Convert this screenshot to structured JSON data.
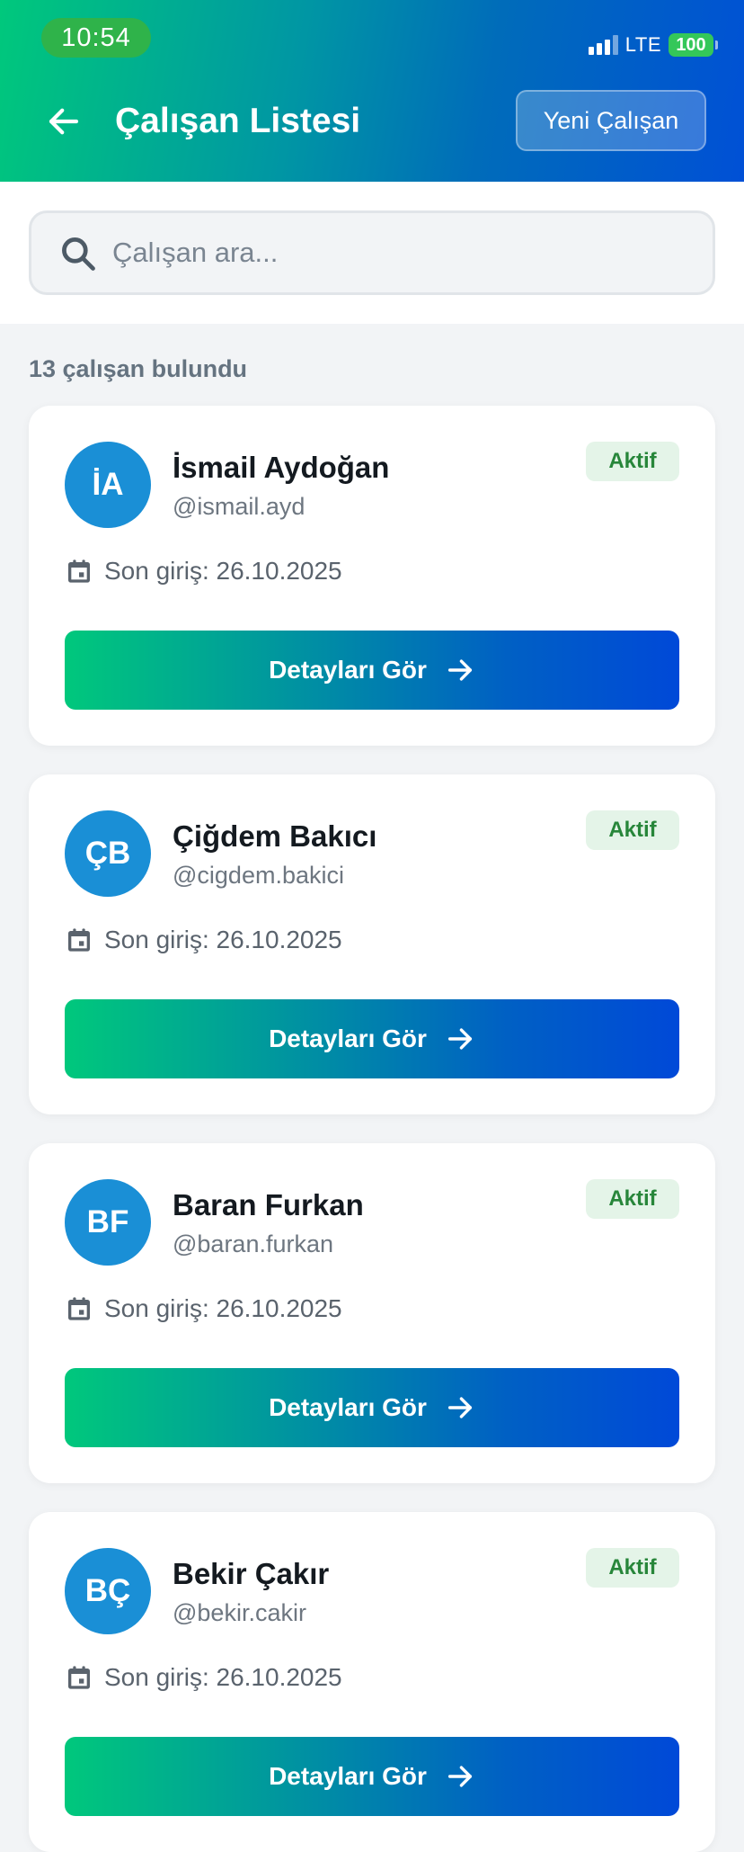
{
  "status_bar": {
    "time": "10:54",
    "network": "LTE",
    "battery": "100"
  },
  "header": {
    "title": "Çalışan Listesi",
    "new_button_label": "Yeni Çalışan",
    "back_icon": "arrow-left-icon"
  },
  "search": {
    "placeholder": "Çalışan ara...",
    "value": ""
  },
  "results": {
    "count_text": "13 çalışan bulundu"
  },
  "employees": [
    {
      "initials": "İA",
      "name": "İsmail Aydoğan",
      "username": "@ismail.ayd",
      "status": "Aktif",
      "last_login": "Son giriş: 26.10.2025",
      "button_label": "Detayları Gör"
    },
    {
      "initials": "ÇB",
      "name": "Çiğdem Bakıcı",
      "username": "@cigdem.bakici",
      "status": "Aktif",
      "last_login": "Son giriş: 26.10.2025",
      "button_label": "Detayları Gör"
    },
    {
      "initials": "BF",
      "name": "Baran Furkan",
      "username": "@baran.furkan",
      "status": "Aktif",
      "last_login": "Son giriş: 26.10.2025",
      "button_label": "Detayları Gör"
    },
    {
      "initials": "BÇ",
      "name": "Bekir Çakır",
      "username": "@bekir.cakir",
      "status": "Aktif",
      "last_login": "Son giriş: 26.10.2025",
      "button_label": "Detayları Gör"
    }
  ],
  "colors": {
    "header_gradient_start": "#00c87c",
    "header_gradient_end": "#0050d6",
    "avatar": "#1a8fd6",
    "badge_bg": "#e4f4e8",
    "badge_text": "#27863a",
    "background": "#f2f4f6"
  }
}
